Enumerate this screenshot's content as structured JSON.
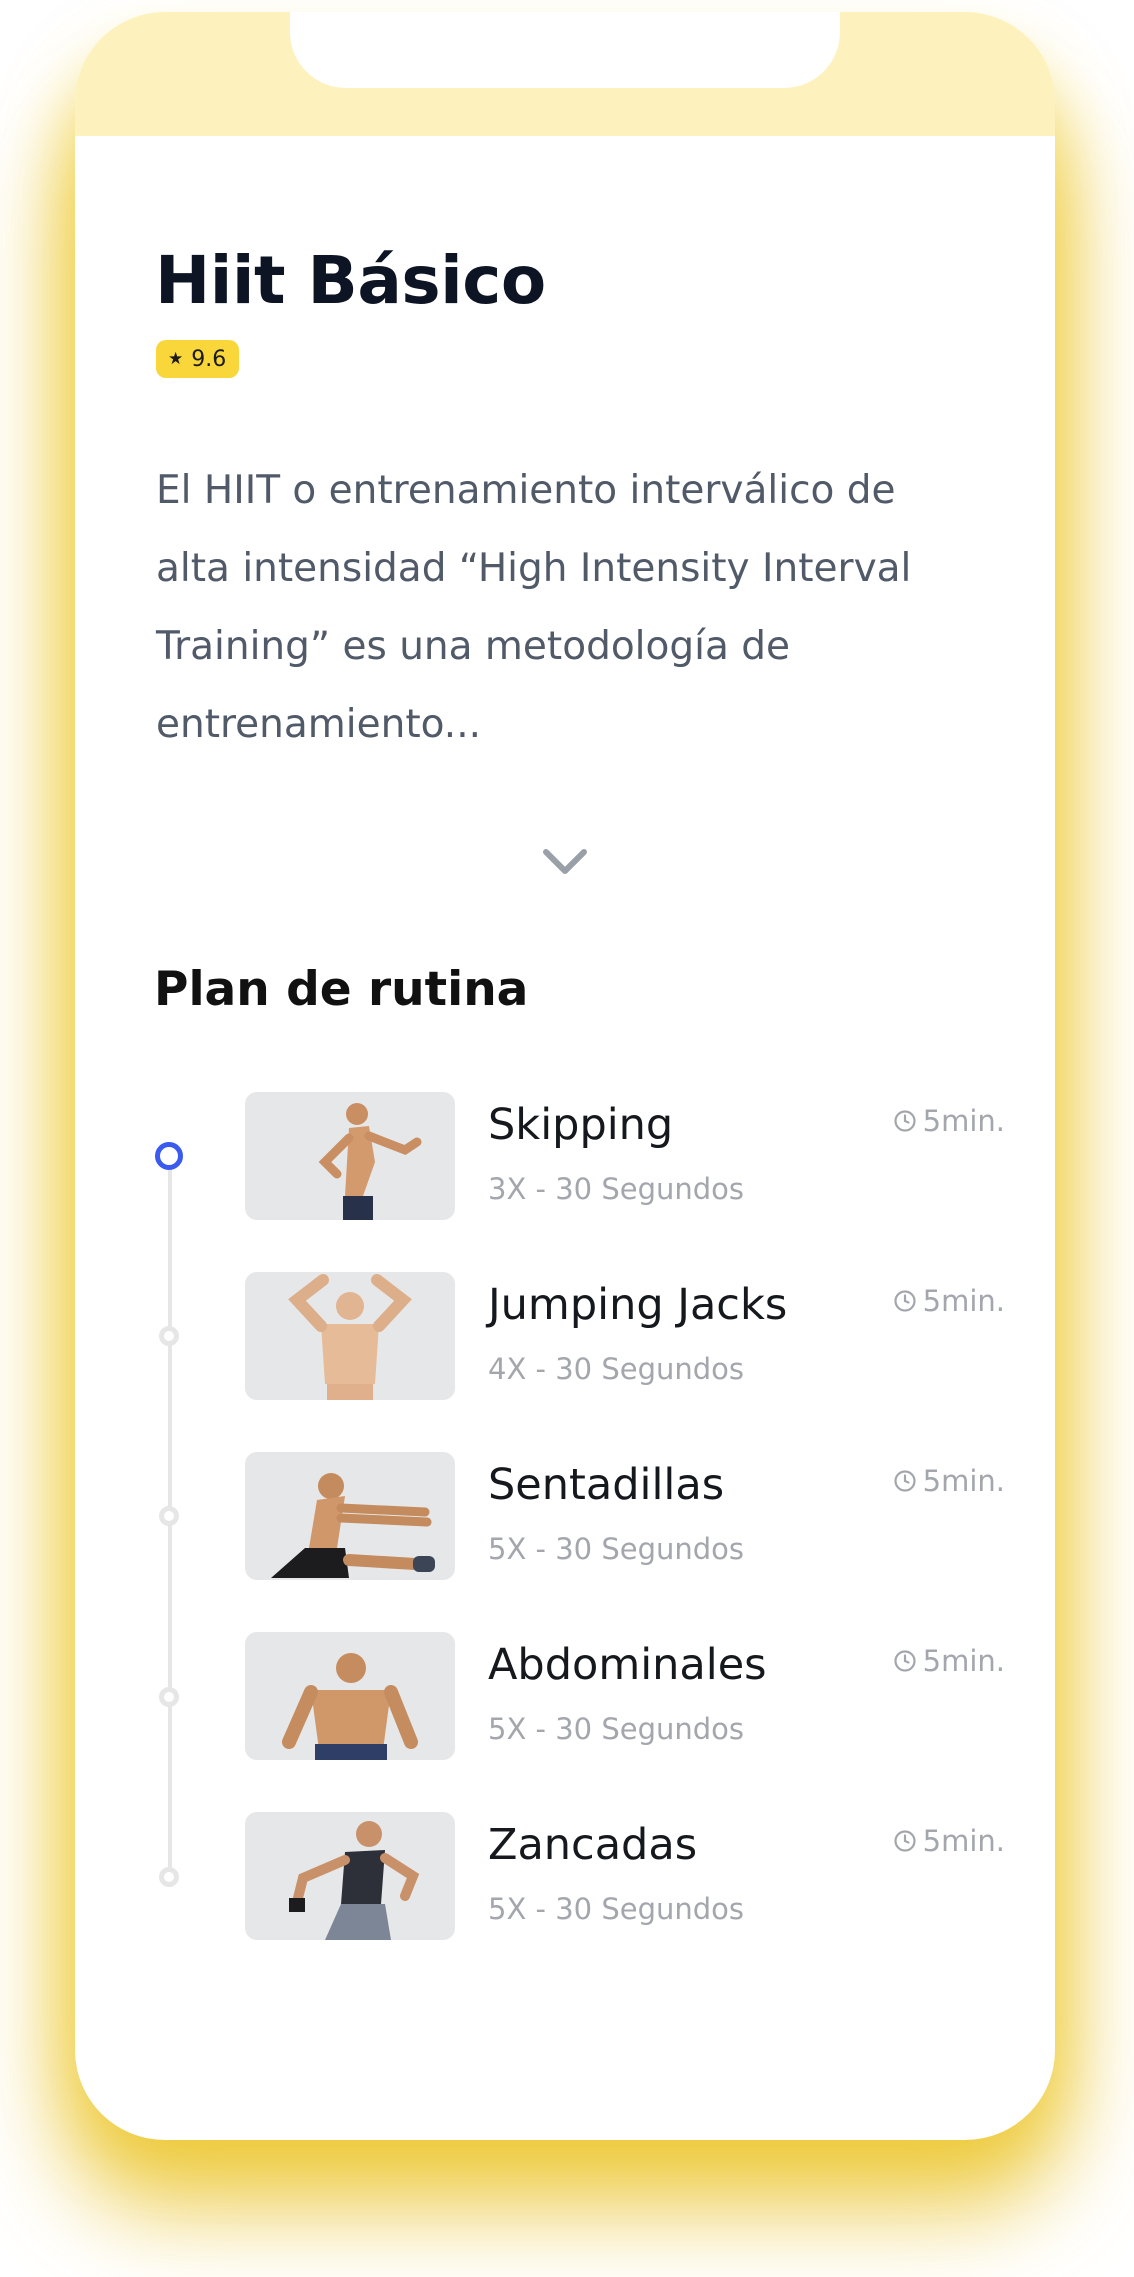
{
  "workout": {
    "title": "Hiit Básico",
    "rating": "9.6",
    "description": "El HIIT o entrenamiento interválico de alta intensidad “High Intensity Interval Training” es una metodología de entrenamiento...",
    "expand_icon": "chevron-down-icon"
  },
  "plan": {
    "title": "Plan de rutina",
    "exercises": [
      {
        "name": "Skipping",
        "sets": "3X - 30 Segundos",
        "duration": "5min.",
        "active": true
      },
      {
        "name": "Jumping Jacks",
        "sets": "4X - 30 Segundos",
        "duration": "5min.",
        "active": false
      },
      {
        "name": "Sentadillas",
        "sets": "5X - 30 Segundos",
        "duration": "5min.",
        "active": false
      },
      {
        "name": "Abdominales",
        "sets": "5X - 30 Segundos",
        "duration": "5min.",
        "active": false
      },
      {
        "name": "Zancadas",
        "sets": "5X - 30 Segundos",
        "duration": "5min.",
        "active": false
      }
    ]
  },
  "colors": {
    "accent_yellow": "#f9d63a",
    "active_blue": "#3a5af0",
    "header_tint": "#fdf2bd"
  }
}
